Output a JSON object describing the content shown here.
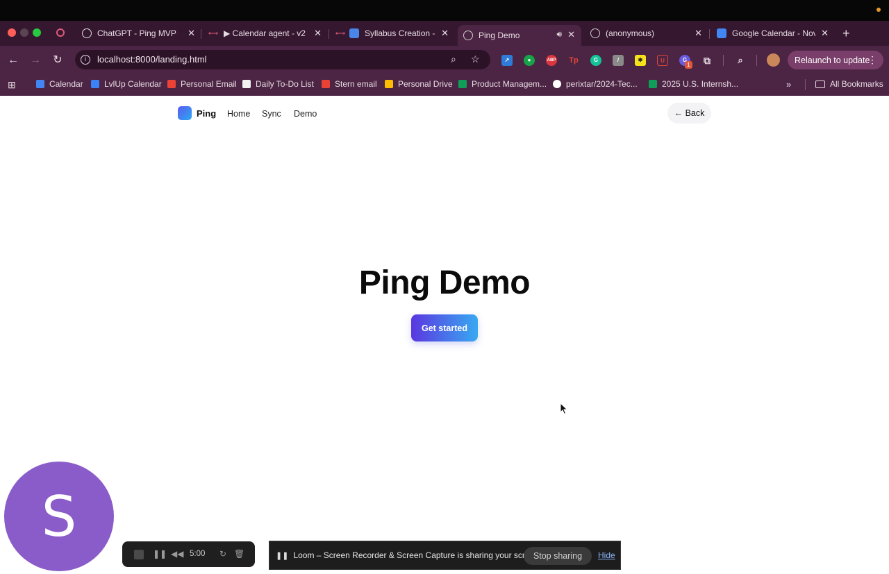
{
  "browser": {
    "tabs": [
      {
        "label": "ChatGPT - Ping MVP",
        "icon": "chatgpt-icon"
      },
      {
        "label": "▶ Calendar agent - v2 (",
        "icon": "loom-icon"
      },
      {
        "label": "Syllabus Creation - (",
        "icon": "loom-icon"
      },
      {
        "label": "Ping Demo",
        "icon": "globe-icon",
        "active": true
      },
      {
        "label": "(anonymous)",
        "icon": "globe-icon"
      },
      {
        "label": "Google Calendar - Nov",
        "icon": "calendar-icon"
      }
    ],
    "url": "localhost:8000/landing.html",
    "relaunch_label": "Relaunch to update",
    "extension_badge": "1",
    "bookmarks": [
      {
        "label": "Calendar",
        "color": "#4285f4"
      },
      {
        "label": "LvlUp Calendar",
        "color": "#3b82f6"
      },
      {
        "label": "Personal Email",
        "color": "#ea4335"
      },
      {
        "label": "Daily To-Do List",
        "color": "#f1f1f1"
      },
      {
        "label": "Stern email",
        "color": "#ea4335"
      },
      {
        "label": "Personal Drive",
        "color": "#fbbc04"
      },
      {
        "label": "Product Managem...",
        "color": "#0f9d58"
      },
      {
        "label": "perixtar/2024-Tec...",
        "color": "#ffffff"
      },
      {
        "label": "2025 U.S. Internsh...",
        "color": "#0f9d58"
      }
    ],
    "all_bookmarks_label": "All Bookmarks"
  },
  "page": {
    "brand": "Ping",
    "nav": [
      "Home",
      "Sync",
      "Demo"
    ],
    "back_label": "← Back",
    "hero_title": "Ping Demo",
    "cta_label": "Get started"
  },
  "overlay": {
    "avatar_letter": "S",
    "recorder_time": "5:00",
    "loom_message": "Loom – Screen Recorder & Screen Capture is sharing your screen.",
    "stop_sharing_label": "Stop sharing",
    "hide_label": "Hide"
  }
}
